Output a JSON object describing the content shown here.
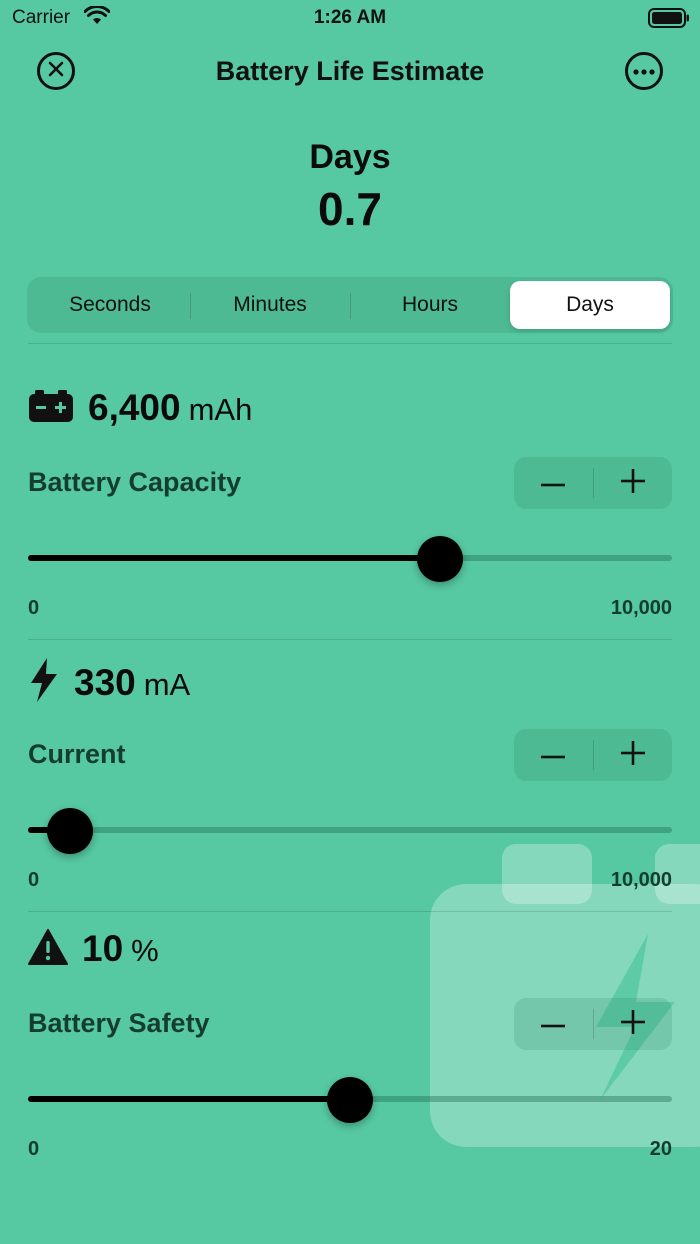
{
  "status_bar": {
    "carrier": "Carrier",
    "time": "1:26 AM"
  },
  "nav": {
    "title": "Battery Life Estimate",
    "close_icon": "close-circle-icon",
    "more_icon": "ellipsis-circle-icon"
  },
  "result": {
    "label": "Days",
    "value": "0.7"
  },
  "units": {
    "selected": "Days",
    "segments": [
      {
        "label": "Seconds"
      },
      {
        "label": "Minutes"
      },
      {
        "label": "Hours"
      },
      {
        "label": "Days"
      }
    ]
  },
  "capacity": {
    "icon": "battery-icon",
    "value": "6,400",
    "unit": "mAh",
    "label": "Battery Capacity",
    "min_label": "0",
    "max_label": "10,000",
    "min": 0,
    "max": 10000,
    "current": 6400
  },
  "current": {
    "icon": "bolt-icon",
    "value": "330",
    "unit": "mA",
    "label": "Current",
    "min_label": "0",
    "max_label": "10,000",
    "min": 0,
    "max": 10000,
    "current": 330
  },
  "safety": {
    "icon": "warning-icon",
    "value": "10",
    "unit": "%",
    "label": "Battery Safety",
    "min_label": "0",
    "max_label": "20",
    "min": 0,
    "max": 20,
    "current": 10
  },
  "colors": {
    "background": "#56c9a2",
    "accent": "#000000",
    "segment_active": "#ffffff"
  }
}
